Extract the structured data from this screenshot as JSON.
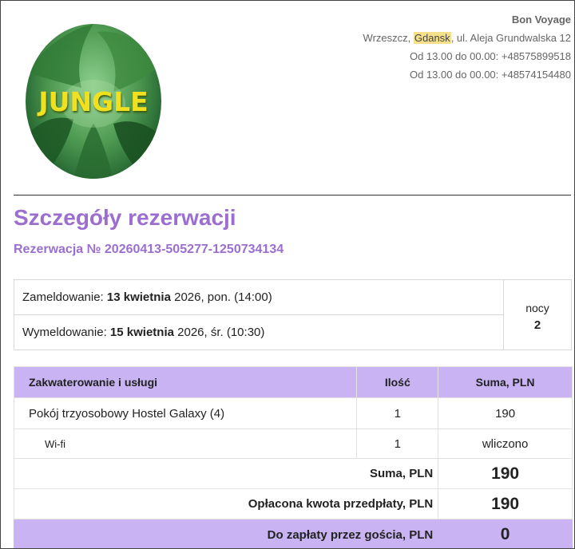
{
  "hotel": {
    "logo_text": "JUNGLE",
    "name": "Bon Voyage",
    "address_prefix": "Wrzeszcz, ",
    "address_city": "Gdansk",
    "address_suffix": ", ul. Aleja Grundwalska 12",
    "phone_1": "Od 13.00 do 00.00: +48575899518",
    "phone_2": "Od 13.00 do 00.00: +48574154480"
  },
  "reservation": {
    "title": "Szczegóły rezerwacji",
    "number": "Rezerwacja № 20260413-505277-1250734134"
  },
  "dates": {
    "checkin_label": "Zameldowanie: ",
    "checkin_date": "13 kwietnia",
    "checkin_rest": " 2026, pon. (14:00)",
    "checkout_label": "Wymeldowanie: ",
    "checkout_date": "15 kwietnia",
    "checkout_rest": " 2026, śr. (10:30)",
    "nights_label": "nocy",
    "nights_count": "2"
  },
  "services": {
    "headers": {
      "service": "Zakwaterowanie i usługi",
      "quantity": "Ilość",
      "total": "Suma, PLN"
    },
    "rows": [
      {
        "name": "Pokój trzyosobowy Hostel Galaxy (4)",
        "qty": "1",
        "total": "190"
      },
      {
        "name": "Wi-fi",
        "qty": "1",
        "total": "wliczono"
      }
    ],
    "sum_label": "Suma, PLN",
    "sum_value": "190",
    "prepaid_label": "Opłacona kwota przedpłaty, PLN",
    "prepaid_value": "190",
    "due_label": "Do zapłaty przez gościa, PLN",
    "due_value": "0"
  },
  "colors": {
    "accent": "#9b6ed0",
    "table_header": "#c9b3f2",
    "highlight": "#f7e08a"
  }
}
